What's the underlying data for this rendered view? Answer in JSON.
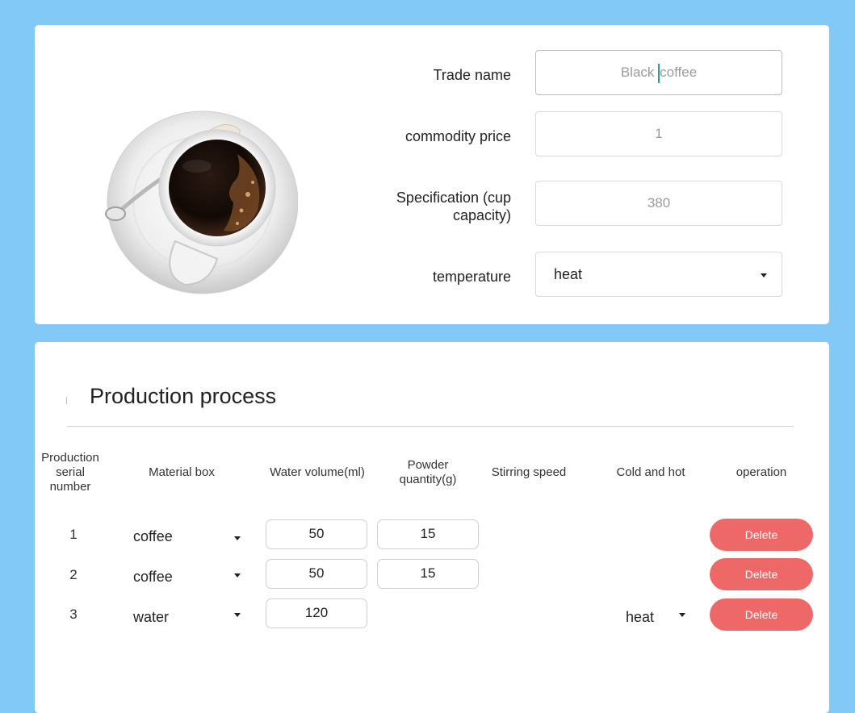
{
  "product_form": {
    "image": "black-coffee-cup",
    "trade_name": {
      "label": "Trade name",
      "value_before_caret": "Black ",
      "value_after_caret": "coffee"
    },
    "commodity_price": {
      "label": "commodity price",
      "value": "1"
    },
    "specification": {
      "label_line1": "Specification (cup",
      "label_line2": "capacity)",
      "value": "380"
    },
    "temperature": {
      "label": "temperature",
      "value": "heat"
    }
  },
  "production": {
    "title": "Production process",
    "headers": {
      "serial_line1": "Production",
      "serial_line2": "serial",
      "serial_line3": "number",
      "material": "Material box",
      "water": "Water volume(ml)",
      "powder_line1": "Powder",
      "powder_line2": "quantity(g)",
      "stirring": "Stirring speed",
      "cold_hot": "Cold and hot",
      "operation": "operation"
    },
    "rows": [
      {
        "num": "1",
        "material": "coffee",
        "water": "50",
        "powder": "15",
        "cold_hot": "",
        "action": "Delete"
      },
      {
        "num": "2",
        "material": "coffee",
        "water": "50",
        "powder": "15",
        "cold_hot": "",
        "action": "Delete"
      },
      {
        "num": "3",
        "material": "water",
        "water": "120",
        "powder": "",
        "cold_hot": "heat",
        "action": "Delete"
      }
    ]
  },
  "colors": {
    "background": "#83c9f8",
    "delete": "#ef6868",
    "caret": "#1aa596"
  }
}
